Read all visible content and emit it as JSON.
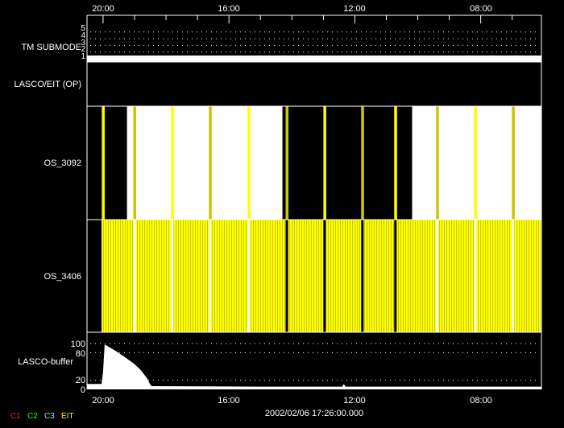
{
  "chart_data": {
    "type": "timeline",
    "x_axis": {
      "range_hours": [
        20.51,
        6.07
      ],
      "ticks": [
        {
          "hour": 20,
          "label": "20:00"
        },
        {
          "hour": 16,
          "label": "16:00"
        },
        {
          "hour": 12,
          "label": "12:00"
        },
        {
          "hour": 8,
          "label": "08:00"
        }
      ],
      "minor_tick_every_hours": 1,
      "direction": "decreasing"
    },
    "panels": {
      "tm_submode": {
        "label": "TM SUBMODE",
        "y_ticks": [
          "1",
          "2",
          "3",
          "4",
          "5"
        ],
        "ylim": [
          1,
          5
        ],
        "grid": true,
        "segments": [
          {
            "from": 20.51,
            "to": 6.07,
            "value": 1
          }
        ]
      },
      "lasco_eit": {
        "label": "LASCO/EIT (OP)"
      },
      "os_3092": {
        "label": "OS_3092",
        "black_spans": [
          [
            20.51,
            19.24
          ],
          [
            14.3,
            10.18
          ]
        ],
        "markers": [
          {
            "hour": 20.0,
            "color": "#ffff00"
          },
          {
            "hour": 19.0,
            "color": "#c8c800"
          },
          {
            "hour": 17.8,
            "color": "#ffff00"
          },
          {
            "hour": 16.6,
            "color": "#c8c800"
          },
          {
            "hour": 15.37,
            "color": "#ffff00"
          },
          {
            "hour": 14.16,
            "color": "#c8c800"
          },
          {
            "hour": 12.96,
            "color": "#ffff00"
          },
          {
            "hour": 11.76,
            "color": "#c8c800"
          },
          {
            "hour": 10.71,
            "color": "#ffff00"
          },
          {
            "hour": 9.38,
            "color": "#c8c800"
          },
          {
            "hour": 8.17,
            "color": "#ffff00"
          },
          {
            "hour": 6.97,
            "color": "#c8c800"
          }
        ]
      },
      "os_3406": {
        "label": "OS_3406",
        "span": [
          20.05,
          6.07
        ],
        "gaps": [
          19.0,
          17.8,
          16.6,
          15.37,
          14.16,
          12.96,
          11.76,
          10.71,
          9.38,
          8.17,
          6.97
        ],
        "colors": [
          "#ffff00",
          "#c8c800"
        ]
      },
      "lasco_buffer": {
        "label": "LASCO-buffer",
        "y_ticks": [
          0,
          20,
          80,
          100
        ],
        "ylim": [
          0,
          100
        ],
        "grid_at": [
          20,
          80,
          100
        ],
        "points": [
          [
            20.51,
            12
          ],
          [
            20.05,
            12
          ],
          [
            20.04,
            17
          ],
          [
            20.0,
            38
          ],
          [
            19.95,
            98
          ],
          [
            19.85,
            94
          ],
          [
            19.6,
            84
          ],
          [
            19.3,
            70
          ],
          [
            19.0,
            55
          ],
          [
            18.8,
            42
          ],
          [
            18.6,
            24
          ],
          [
            18.5,
            10
          ],
          [
            18.45,
            7
          ],
          [
            15.0,
            6
          ],
          [
            12.4,
            6
          ],
          [
            12.35,
            12
          ],
          [
            12.3,
            6
          ],
          [
            7.5,
            6
          ],
          [
            6.07,
            6
          ]
        ]
      }
    },
    "footer": {
      "date": "2002/02/06 17:26:00.000",
      "legend": [
        {
          "label": "C1",
          "color": "#ff2020"
        },
        {
          "label": "C2",
          "color": "#20ff20"
        },
        {
          "label": "C3",
          "color": "#a0e0ff"
        },
        {
          "label": "EIT",
          "color": "#ffff00"
        }
      ]
    }
  }
}
